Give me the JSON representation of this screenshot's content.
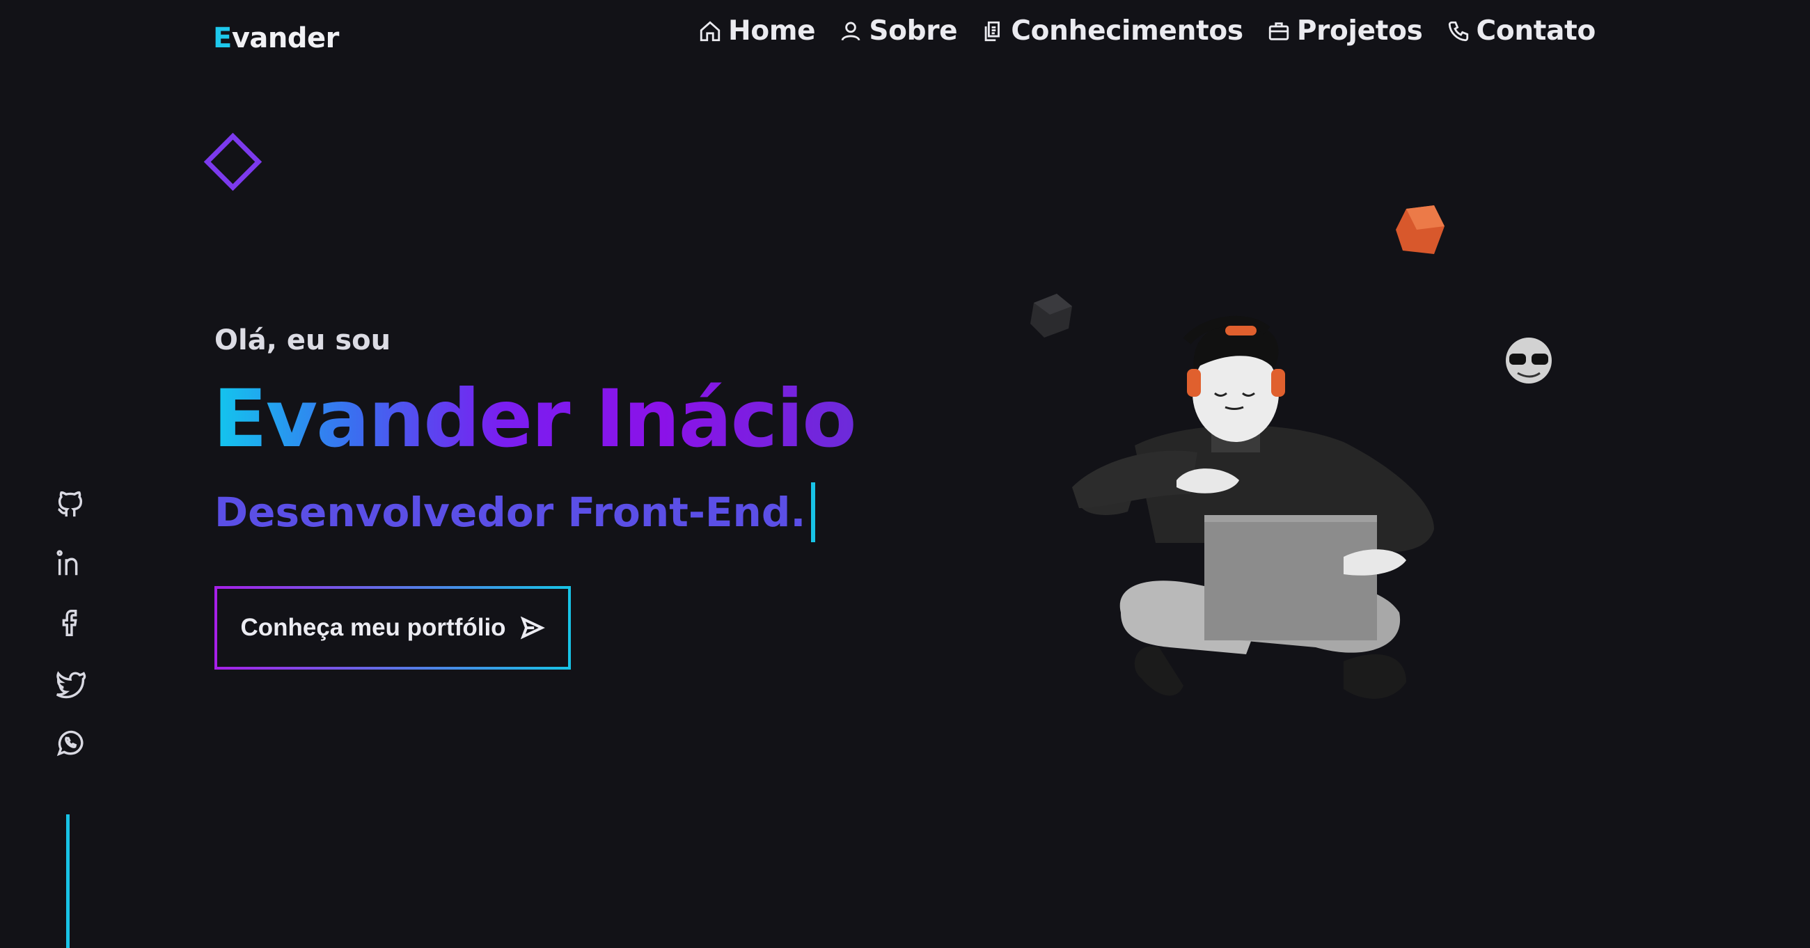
{
  "header": {
    "logo_first_letter": "E",
    "logo_rest": "vander",
    "nav": [
      {
        "label": "Home",
        "icon": "home-icon"
      },
      {
        "label": "Sobre",
        "icon": "user-icon"
      },
      {
        "label": "Conhecimentos",
        "icon": "document-icon"
      },
      {
        "label": "Projetos",
        "icon": "briefcase-icon"
      },
      {
        "label": "Contato",
        "icon": "phone-icon"
      }
    ]
  },
  "hero": {
    "greeting": "Olá, eu sou",
    "name": "Evander Inácio",
    "role": "Desenvolvedor Front-End.",
    "cta_label": "Conheça meu portfólio"
  },
  "social": [
    "github-icon",
    "linkedin-icon",
    "facebook-icon",
    "twitter-icon",
    "whatsapp-icon"
  ],
  "colors": {
    "background": "#121217",
    "accent_cyan": "#18c3e6",
    "accent_purple": "#7c3aed",
    "role_text": "#5b4fe6"
  }
}
